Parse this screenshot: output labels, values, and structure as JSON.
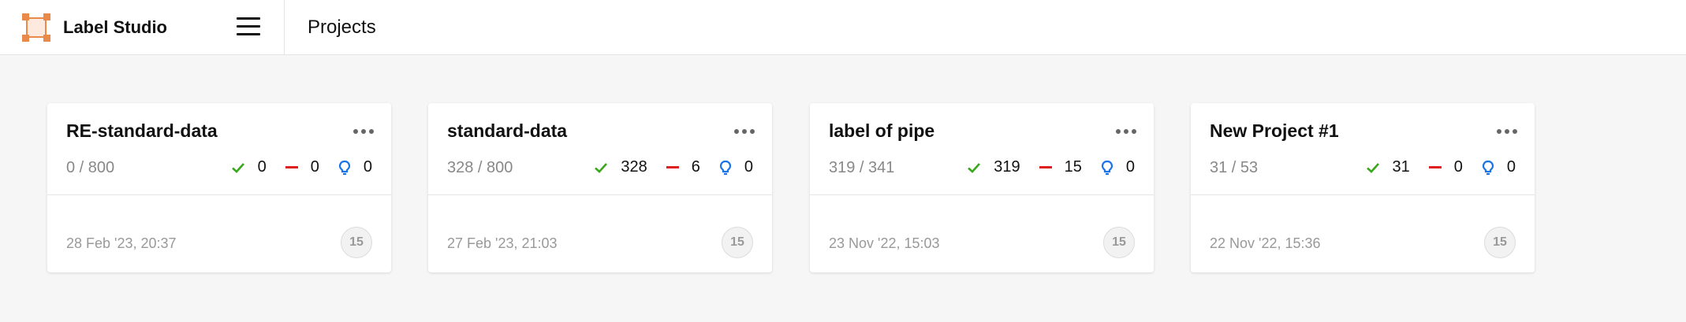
{
  "app": {
    "name": "Label Studio",
    "logo_icon": "label-studio-logo-icon",
    "accent": "#e9894a"
  },
  "header": {
    "title": "Projects",
    "menu_icon": "hamburger-menu-icon"
  },
  "colors": {
    "completed": "#3aa71c",
    "skipped": "#e02020",
    "predictions": "#1a74e8"
  },
  "projects": [
    {
      "title": "RE-standard-data",
      "progress": "0 / 800",
      "completed": "0",
      "skipped": "0",
      "predictions": "0",
      "date": "28 Feb '23, 20:37",
      "avatar": "15"
    },
    {
      "title": "standard-data",
      "progress": "328 / 800",
      "completed": "328",
      "skipped": "6",
      "predictions": "0",
      "date": "27 Feb '23, 21:03",
      "avatar": "15"
    },
    {
      "title": "label of pipe",
      "progress": "319 / 341",
      "completed": "319",
      "skipped": "15",
      "predictions": "0",
      "date": "23 Nov '22, 15:03",
      "avatar": "15"
    },
    {
      "title": "New Project #1",
      "progress": "31 / 53",
      "completed": "31",
      "skipped": "0",
      "predictions": "0",
      "date": "22 Nov '22, 15:36",
      "avatar": "15"
    }
  ]
}
